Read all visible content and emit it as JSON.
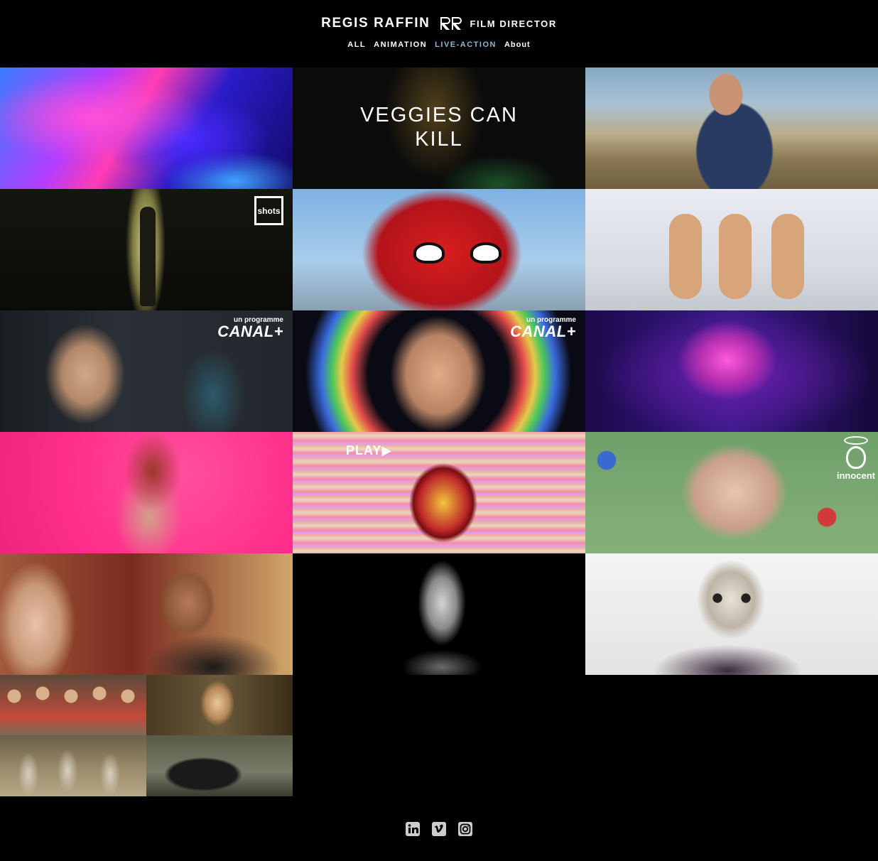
{
  "header": {
    "name": "REGIS RAFFIN",
    "logo_icon": "rr-monogram-icon",
    "role": "FILM DIRECTOR"
  },
  "nav": {
    "items": [
      {
        "label": "ALL",
        "active": false
      },
      {
        "label": "ANIMATION",
        "active": false
      },
      {
        "label": "LIVE-ACTION",
        "active": true
      },
      {
        "label": "About",
        "active": false
      }
    ],
    "active_color": "#8fb6d4"
  },
  "tiles": [
    {
      "overlay_title": ""
    },
    {
      "overlay_title": "VEGGIES CAN KILL",
      "overlay_title_line1": "VEGGIES CAN",
      "overlay_title_line2": "KILL"
    },
    {
      "overlay_title": ""
    },
    {
      "badge": "shots"
    },
    {
      "overlay_title": ""
    },
    {
      "overlay_title": ""
    },
    {
      "badge_small": "un programme",
      "badge_big": "CANAL+"
    },
    {
      "badge_small": "un programme",
      "badge_big": "CANAL+"
    },
    {
      "overlay_title": ""
    },
    {
      "overlay_title": ""
    },
    {
      "badge": "PLAY▶"
    },
    {
      "badge": "innocent"
    },
    {
      "overlay_title": ""
    },
    {
      "overlay_title": ""
    },
    {
      "overlay_title": ""
    },
    {
      "overlay_title": ""
    }
  ],
  "footer": {
    "social": [
      {
        "icon": "linkedin-icon"
      },
      {
        "icon": "vimeo-icon"
      },
      {
        "icon": "instagram-icon"
      }
    ]
  }
}
